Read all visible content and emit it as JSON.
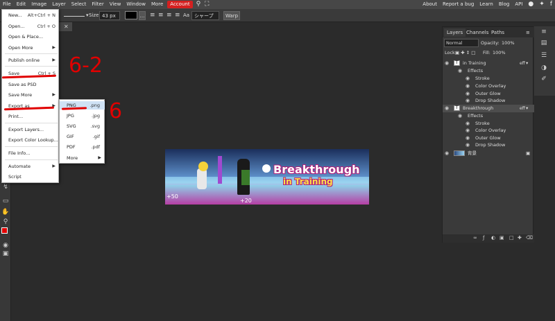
{
  "menubar": {
    "items": [
      "File",
      "Edit",
      "Image",
      "Layer",
      "Select",
      "Filter",
      "View",
      "Window",
      "More",
      "Account"
    ],
    "right_links": [
      "About",
      "Report a bug",
      "Learn",
      "Blog",
      "API"
    ]
  },
  "options": {
    "size_label": "Size:",
    "size_value": "43 px",
    "font_label": "Aa",
    "font_value": "シャープ",
    "warp_label": "Warp"
  },
  "file_menu": {
    "items": [
      {
        "label": "New...",
        "shortcut": "Alt+Ctrl + N"
      },
      {
        "label": "Open...",
        "shortcut": "Ctrl + O"
      },
      {
        "label": "Open & Place...",
        "shortcut": ""
      },
      {
        "label": "Open More",
        "shortcut": "▶"
      },
      {
        "label": "Publish online",
        "shortcut": "▶"
      },
      {
        "label": "Save",
        "shortcut": "Ctrl + S"
      },
      {
        "label": "Save as PSD",
        "shortcut": ""
      },
      {
        "label": "Save More",
        "shortcut": "▶"
      },
      {
        "label": "Export as",
        "shortcut": "▶"
      },
      {
        "label": "Print...",
        "shortcut": ""
      },
      {
        "label": "Export Layers...",
        "shortcut": ""
      },
      {
        "label": "Export Color Lookup...",
        "shortcut": ""
      },
      {
        "label": "File Info...",
        "shortcut": ""
      },
      {
        "label": "Automate",
        "shortcut": "▶"
      },
      {
        "label": "Script",
        "shortcut": ""
      }
    ]
  },
  "export_menu": {
    "items": [
      {
        "label": "PNG",
        "ext": ".png"
      },
      {
        "label": "JPG",
        "ext": ".jpg"
      },
      {
        "label": "SVG",
        "ext": ".svg"
      },
      {
        "label": "GIF",
        "ext": ".gif"
      },
      {
        "label": "PDF",
        "ext": ".pdf"
      },
      {
        "label": "More",
        "ext": "▶"
      }
    ]
  },
  "annotations": {
    "step_a": "6-2",
    "step_b": "6",
    "color": "#e00000"
  },
  "canvas": {
    "title_line1": "Breakthrough",
    "title_line2": "in Training",
    "num_left": "+50",
    "num_mid": "+20"
  },
  "layers_panel": {
    "tabs": [
      "Layers",
      "Channels",
      "Paths"
    ],
    "blend_mode": "Normal",
    "opacity_label": "Opacity:",
    "opacity_value": "100%",
    "lock_label": "Lock:",
    "fill_label": "Fill:",
    "fill_value": "100%",
    "fx_label": "eff",
    "layers": [
      {
        "name": "in Training",
        "kind": "T"
      },
      {
        "name": "Effects"
      },
      {
        "name": "Stroke"
      },
      {
        "name": "Color Overlay"
      },
      {
        "name": "Outer Glow"
      },
      {
        "name": "Drop Shadow"
      },
      {
        "name": "Breakthrough",
        "kind": "T"
      },
      {
        "name": "Effects"
      },
      {
        "name": "Stroke"
      },
      {
        "name": "Color Overlay"
      },
      {
        "name": "Outer Glow"
      },
      {
        "name": "Drop Shadow"
      },
      {
        "name": "背景"
      }
    ]
  }
}
